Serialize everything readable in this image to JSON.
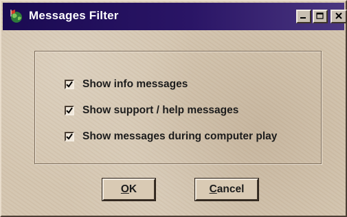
{
  "window": {
    "title": "Messages Filter",
    "title_icon": "globe-flag-icon",
    "controls": {
      "minimize": "minimize-icon",
      "maximize": "maximize-icon",
      "close": "close-icon"
    }
  },
  "options": [
    {
      "label": "Show info messages",
      "checked": true
    },
    {
      "label": "Show support / help messages",
      "checked": true
    },
    {
      "label": "Show messages during computer play",
      "checked": true
    }
  ],
  "buttons": {
    "ok": {
      "accel": "O",
      "rest": "K"
    },
    "cancel": {
      "accel": "C",
      "rest": "ancel"
    }
  },
  "colors": {
    "titlebar": "#1a0a52",
    "window_bg": "#d3c4ae",
    "text": "#1c1c1c"
  }
}
